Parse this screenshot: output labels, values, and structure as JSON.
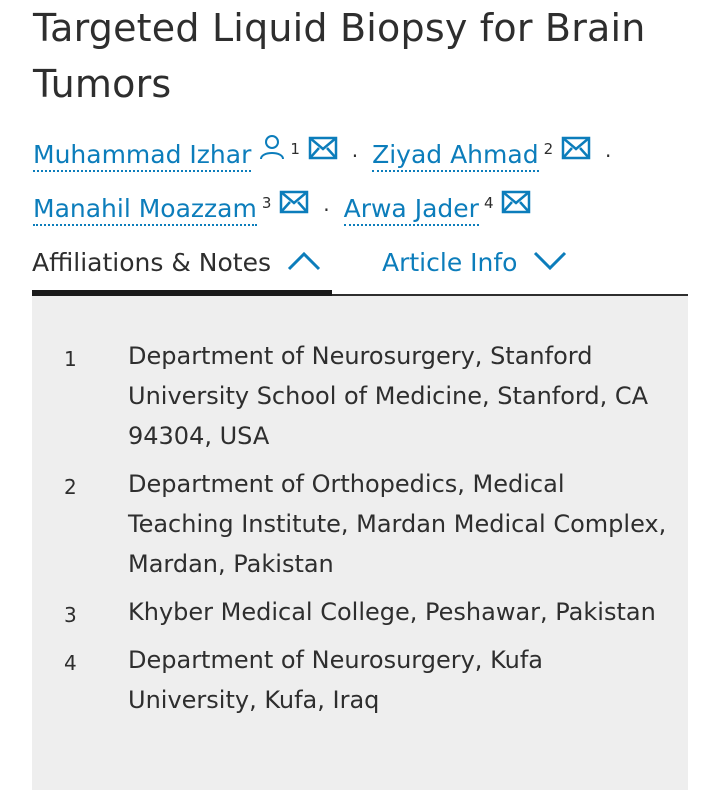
{
  "article": {
    "title": "Targeted Liquid Biopsy for Brain Tumors"
  },
  "authors": [
    {
      "name": "Muhammad Izhar",
      "sup": "1",
      "has_person_icon": true,
      "icons": [
        "person-icon",
        "envelope-icon"
      ]
    },
    {
      "name": "Ziyad Ahmad",
      "sup": "2",
      "icons": [
        "envelope-icon"
      ]
    },
    {
      "name": "Manahil Moazzam",
      "sup": "3",
      "icons": [
        "envelope-icon"
      ]
    },
    {
      "name": "Arwa Jader",
      "sup": "4",
      "icons": [
        "envelope-icon"
      ]
    }
  ],
  "separator": "·",
  "tabs": [
    {
      "label": "Affiliations & Notes",
      "active": true,
      "icon": "chevron-up-icon"
    },
    {
      "label": "Article Info",
      "active": false,
      "icon": "chevron-down-icon"
    }
  ],
  "affiliations": [
    {
      "num": "1",
      "text": "Department of Neurosurgery, Stanford University School of Medicine, Stanford, CA 94304, USA"
    },
    {
      "num": "2",
      "text": "Department of Orthopedics, Medical Teaching Institute, Mardan Medical Complex, Mardan, Pakistan"
    },
    {
      "num": "3",
      "text": "Khyber Medical College, Peshawar, Pakistan"
    },
    {
      "num": "4",
      "text": "Department of Neurosurgery, Kufa University, Kufa, Iraq"
    }
  ],
  "colors": {
    "link": "#0c7dbb",
    "text": "#2e2e2e",
    "panel_bg": "#eeeeee"
  }
}
